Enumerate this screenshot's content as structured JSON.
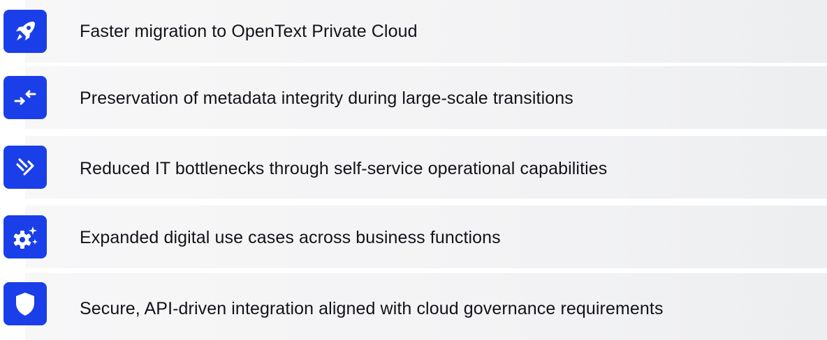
{
  "accent_color": "#1a3fe8",
  "items": [
    {
      "icon": "rocket-icon",
      "label": "Faster migration to OpenText Private Cloud"
    },
    {
      "icon": "arrows-exchange-icon",
      "label": "Preservation of metadata integrity during large-scale transitions"
    },
    {
      "icon": "broken-link-icon",
      "label": "Reduced IT bottlenecks through self-service operational capabilities"
    },
    {
      "icon": "gear-sparkle-icon",
      "label": "Expanded digital use cases across business functions"
    },
    {
      "icon": "shield-icon",
      "label": "Secure, API-driven integration aligned with cloud governance requirements"
    }
  ]
}
